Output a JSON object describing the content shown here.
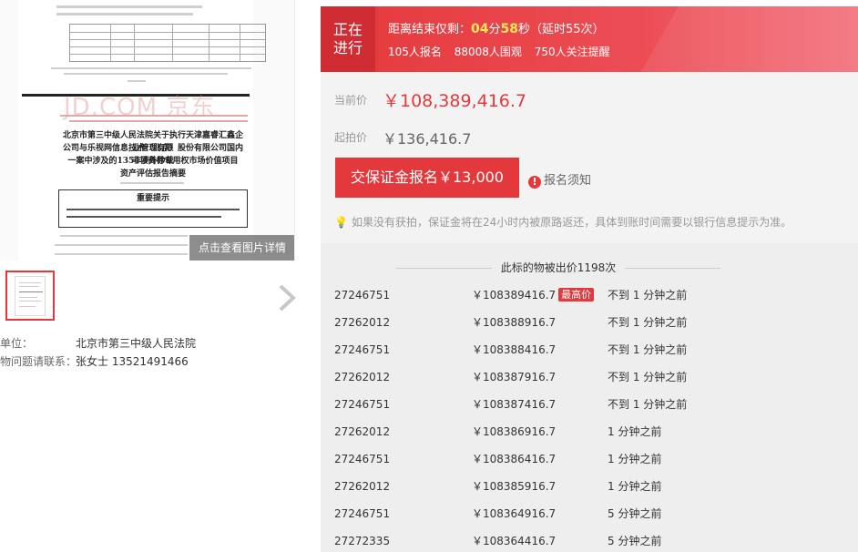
{
  "gallery": {
    "watermark": "JD.COM 京东",
    "view_detail_label": "点击查看图片详情",
    "doc_title_lines": [
      "北京市第三中级人民法院关于执行天津嘉睿汇鑫企业管理有限",
      "公司与乐视网信息技术（北京）股份有限公司国内非涉外仲裁",
      "一案中涉及的1354项商标专用权市场价值项目",
      "资产评估报告摘要"
    ],
    "doc_box_title": "重要提示"
  },
  "info": {
    "unit_label": "单位：",
    "unit_value": "北京市第三中级人民法院",
    "contact_label": "物问题请联系：",
    "contact_value": "张女士 13521491466"
  },
  "banner": {
    "status": [
      "正在",
      "进行"
    ],
    "countdown_prefix": "距离结束仅剩：",
    "minutes": "04",
    "minute_unit": "分",
    "seconds": "58",
    "second_unit": "秒",
    "extension": "（延时55次）",
    "stats": [
      "105人报名",
      "88008人围观",
      "750人关注提醒"
    ]
  },
  "price": {
    "current_label": "当前价",
    "current_value": "￥108,389,416.7",
    "start_label": "起拍价",
    "start_value": "￥136,416.7",
    "deposit_button": "交保证金报名￥13,000",
    "notice_link": "报名须知",
    "tip": "如果没有获拍，保证金将在24小时内被原路返还，具体到账时间需要以银行信息提示为准。"
  },
  "history": {
    "title": "此标的物被出价1198次",
    "top_badge": "最高价",
    "bids": [
      {
        "uid": "27246751",
        "amount": "￥108389416.7",
        "time": "不到 1 分钟之前",
        "top": true
      },
      {
        "uid": "27262012",
        "amount": "￥108388916.7",
        "time": "不到 1 分钟之前"
      },
      {
        "uid": "27246751",
        "amount": "￥108388416.7",
        "time": "不到 1 分钟之前"
      },
      {
        "uid": "27262012",
        "amount": "￥108387916.7",
        "time": "不到 1 分钟之前"
      },
      {
        "uid": "27246751",
        "amount": "￥108387416.7",
        "time": "不到 1 分钟之前"
      },
      {
        "uid": "27262012",
        "amount": "￥108386916.7",
        "time": "1 分钟之前"
      },
      {
        "uid": "27246751",
        "amount": "￥108386416.7",
        "time": "1 分钟之前"
      },
      {
        "uid": "27262012",
        "amount": "￥108385916.7",
        "time": "1 分钟之前"
      },
      {
        "uid": "27246751",
        "amount": "￥108364916.7",
        "time": "5 分钟之前"
      },
      {
        "uid": "27272335",
        "amount": "￥108364416.7",
        "time": "5 分钟之前"
      }
    ]
  },
  "colors": {
    "brand_red": "#e4393c",
    "countdown_highlight": "#ffe75c"
  }
}
